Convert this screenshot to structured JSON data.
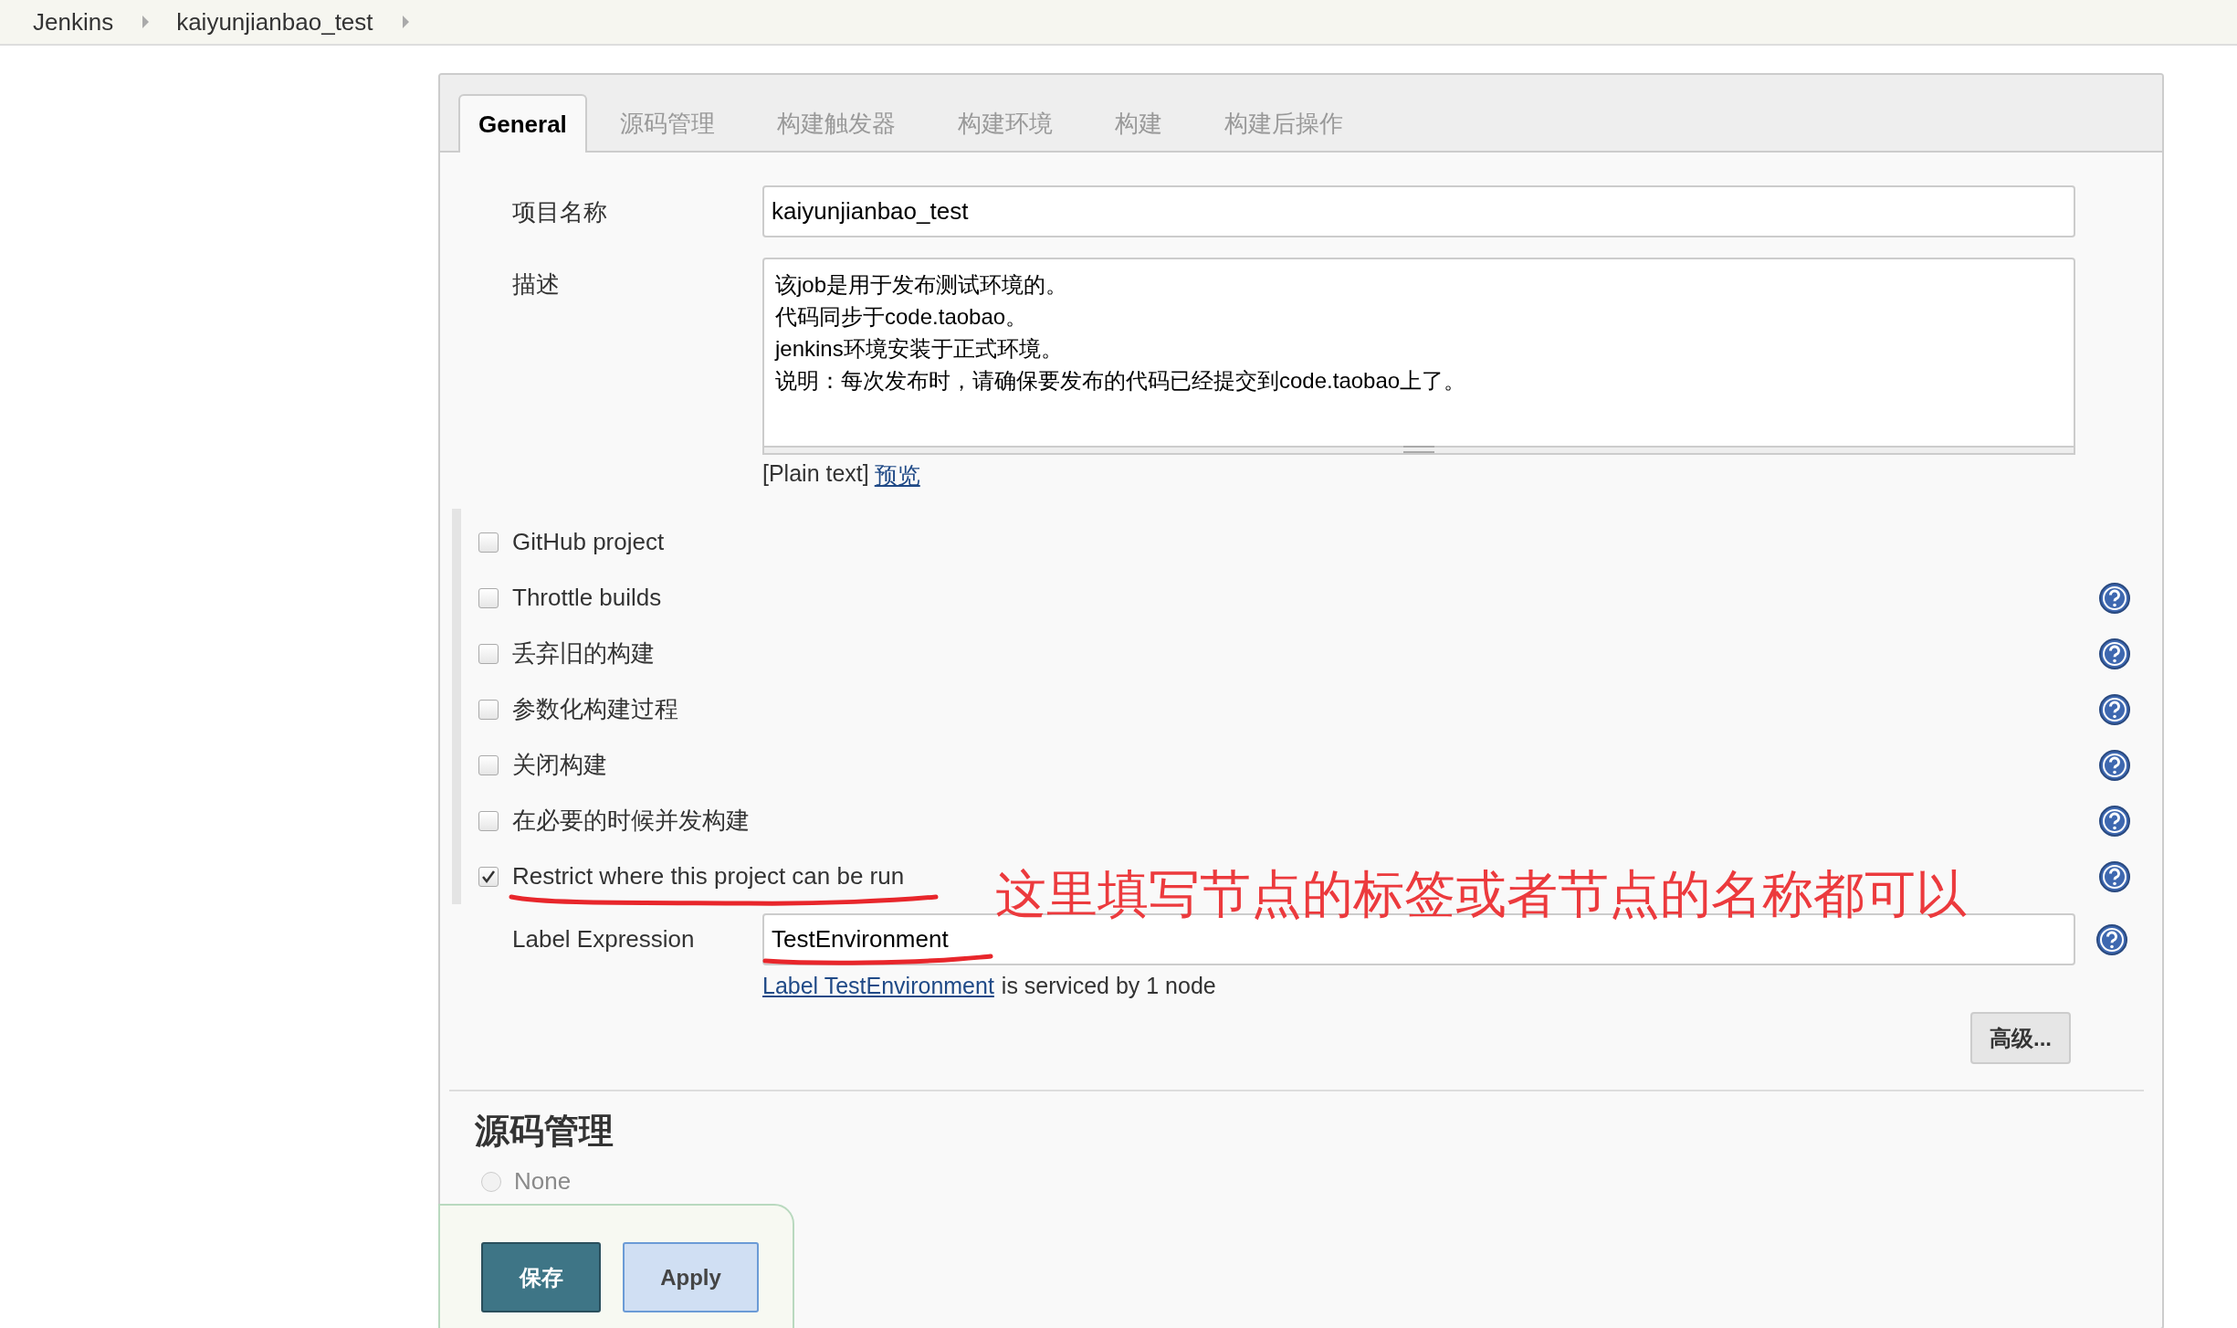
{
  "breadcrumbs": [
    {
      "label": "Jenkins"
    },
    {
      "label": "kaiyunjianbao_test"
    }
  ],
  "tabs": [
    {
      "label": "General",
      "selected": true
    },
    {
      "label": "源码管理",
      "selected": false
    },
    {
      "label": "构建触发器",
      "selected": false
    },
    {
      "label": "构建环境",
      "selected": false
    },
    {
      "label": "构建",
      "selected": false
    },
    {
      "label": "构建后操作",
      "selected": false
    }
  ],
  "fields": [
    {
      "label": "项目名称",
      "value": "kaiyunjianbao_test",
      "kind": "input"
    },
    {
      "label": "描述",
      "lines": [
        "该job是用于发布测试环境的。",
        "代码同步于code.taobao。",
        "jenkins环境安装于正式环境。",
        "说明：每次发布时，请确保要发布的代码已经提交到code.taobao上了。"
      ],
      "kind": "textarea"
    }
  ],
  "description_format": {
    "text": "[Plain text]",
    "link": "预览"
  },
  "options": [
    {
      "label": "GitHub project",
      "checked": false,
      "help": false
    },
    {
      "label": "Throttle builds",
      "checked": false,
      "help": true
    },
    {
      "label": "丢弃旧的构建",
      "checked": false,
      "help": true
    },
    {
      "label": "参数化构建过程",
      "checked": false,
      "help": true
    },
    {
      "label": "关闭构建",
      "checked": false,
      "help": true
    },
    {
      "label": "在必要的时候并发构建",
      "checked": false,
      "help": true
    },
    {
      "label": "Restrict where this project can be run",
      "checked": true,
      "help": true
    }
  ],
  "label_expression": {
    "label": "Label Expression",
    "value": "TestEnvironment",
    "help": true,
    "status_link": "Label TestEnvironment",
    "status_text": "is serviced by 1 node"
  },
  "advanced_button": "高级...",
  "annotation": "这里填写节点的标签或者节点的名称都可以",
  "scm": {
    "title": "源码管理",
    "options": [
      {
        "label": "None",
        "selected": false
      }
    ]
  },
  "buttons": [
    {
      "label": "保存",
      "kind": "primary"
    },
    {
      "label": "Apply",
      "kind": "secondary"
    }
  ]
}
